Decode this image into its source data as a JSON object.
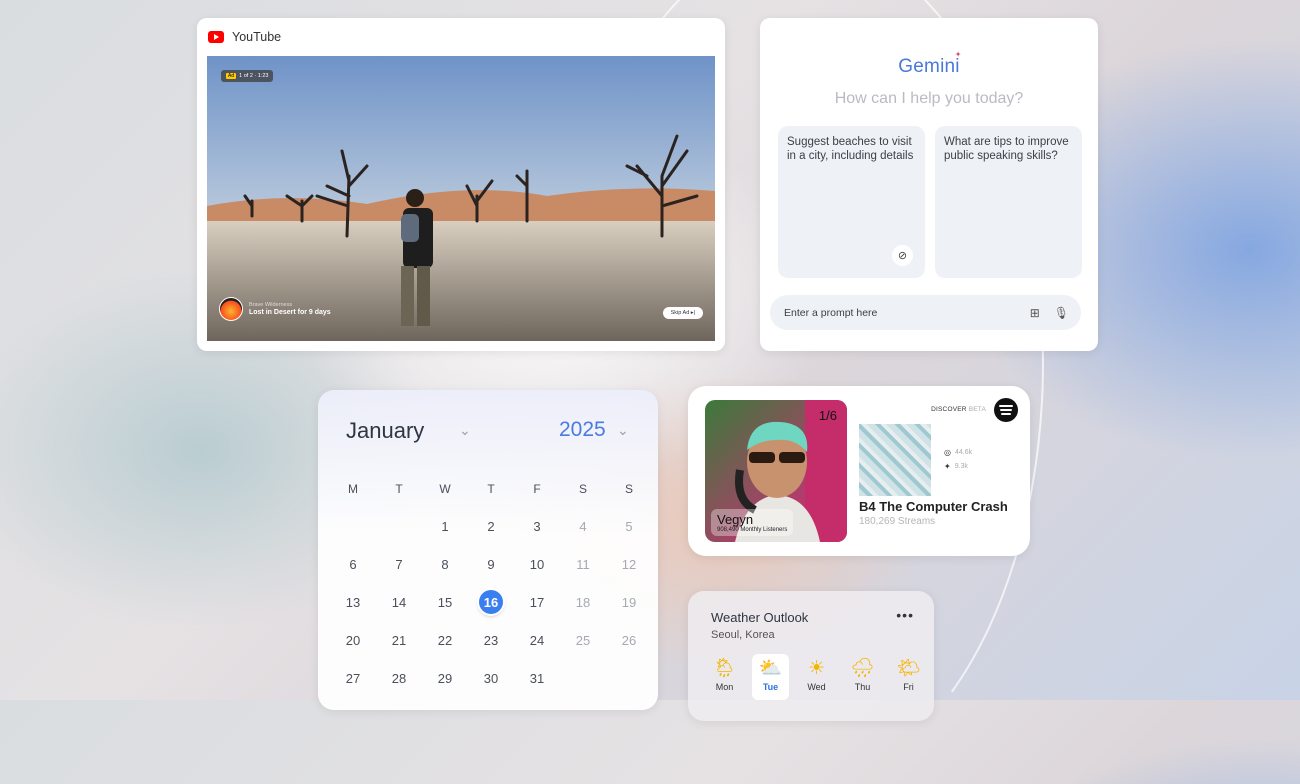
{
  "youtube": {
    "tab_title": "YouTube",
    "icon": "youtube-logo-icon",
    "ad_badge": "1 of 2 · 1:23",
    "ad_badge_mark": "Ad",
    "channel_name": "Brave Wilderness",
    "video_title": "Lost in Desert for 9 days",
    "skip_label": "Skip Ad ▸|"
  },
  "gemini": {
    "logo": "Gemini",
    "prompt_question": "How can I help you today?",
    "suggestions": [
      {
        "text": "Suggest beaches to visit in a city, including details",
        "icon": "compass-icon"
      },
      {
        "text": "What are tips to improve public speaking skills?"
      }
    ],
    "input_placeholder": "Enter a prompt here",
    "icons": [
      "add-image-icon",
      "microphone-icon"
    ]
  },
  "calendar": {
    "month": "January",
    "year": "2025",
    "weekday_headers": [
      "M",
      "T",
      "W",
      "T",
      "F",
      "S",
      "S"
    ],
    "weeks": [
      [
        "",
        "",
        "1",
        "2",
        "3",
        "4",
        "5"
      ],
      [
        "6",
        "7",
        "8",
        "9",
        "10",
        "11",
        "12"
      ],
      [
        "13",
        "14",
        "15",
        "16",
        "17",
        "18",
        "19"
      ],
      [
        "20",
        "21",
        "22",
        "23",
        "24",
        "25",
        "26"
      ],
      [
        "27",
        "28",
        "29",
        "30",
        "31",
        "",
        ""
      ]
    ],
    "selected_day": "16",
    "accent_color": "#3a7ff0"
  },
  "spotify": {
    "discover": "DISCOVER",
    "beta": "BETA",
    "counter": "1/6",
    "artist_name": "Vegyn",
    "monthly_listeners": "908,490 Monthly Listeners",
    "instagram_count": "44.6k",
    "twitter_count": "9.3k",
    "track_title": "B4 The Computer Crash",
    "streams": "180,269 Streams"
  },
  "weather": {
    "title": "Weather Outlook",
    "location": "Seoul, Korea",
    "more": "•••",
    "days": [
      {
        "label": "Mon",
        "icon": "rain-sun-icon",
        "glyph": "🌦"
      },
      {
        "label": "Tue",
        "icon": "partly-cloudy-icon",
        "glyph": "⛅",
        "selected": true
      },
      {
        "label": "Wed",
        "icon": "sun-icon",
        "glyph": "☀"
      },
      {
        "label": "Thu",
        "icon": "cloud-rain-icon",
        "glyph": "🌧"
      },
      {
        "label": "Fri",
        "icon": "partly-sunny-icon",
        "glyph": "🌤"
      }
    ]
  }
}
